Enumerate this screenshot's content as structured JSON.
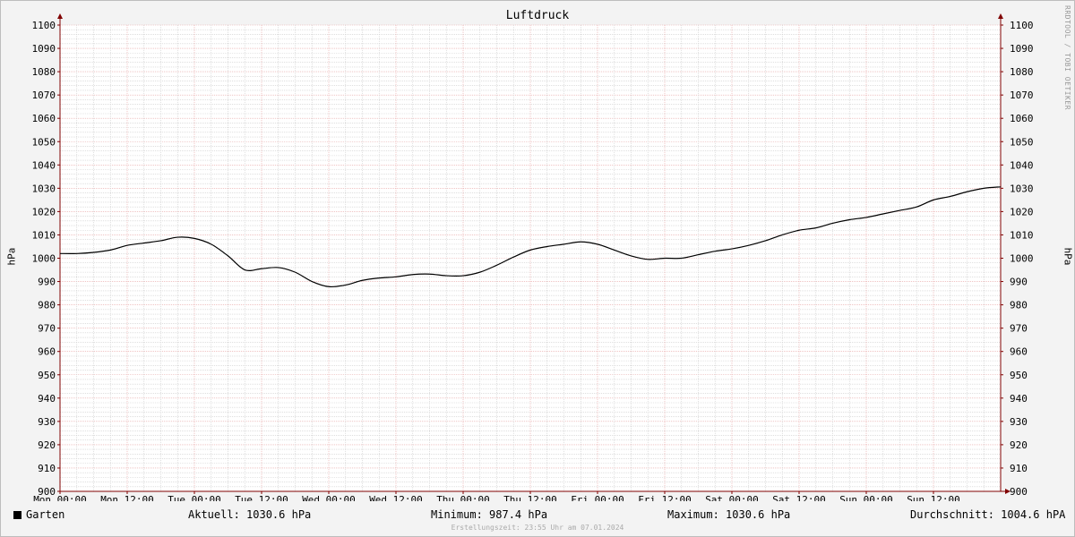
{
  "chart_data": {
    "type": "line",
    "title": "Luftdruck",
    "ylabel": "hPa",
    "ylim": [
      900,
      1100
    ],
    "yticks": [
      900,
      910,
      920,
      930,
      940,
      950,
      960,
      970,
      980,
      990,
      1000,
      1010,
      1020,
      1030,
      1040,
      1050,
      1060,
      1070,
      1080,
      1090,
      1100
    ],
    "xlim": [
      "Mon 00:00",
      "Sun 24:00"
    ],
    "xticks": [
      "Mon 00:00",
      "Mon 12:00",
      "Tue 00:00",
      "Tue 12:00",
      "Wed 00:00",
      "Wed 12:00",
      "Thu 00:00",
      "Thu 12:00",
      "Fri 00:00",
      "Fri 12:00",
      "Sat 00:00",
      "Sat 12:00",
      "Sun 00:00",
      "Sun 12:00"
    ],
    "grid": true,
    "series": [
      {
        "name": "Garten",
        "color": "#000000",
        "x": [
          "Mon 00:00",
          "Mon 03:00",
          "Mon 06:00",
          "Mon 09:00",
          "Mon 12:00",
          "Mon 15:00",
          "Mon 18:00",
          "Mon 21:00",
          "Tue 00:00",
          "Tue 03:00",
          "Tue 06:00",
          "Tue 09:00",
          "Tue 12:00",
          "Tue 15:00",
          "Tue 18:00",
          "Tue 21:00",
          "Wed 00:00",
          "Wed 03:00",
          "Wed 06:00",
          "Wed 09:00",
          "Wed 12:00",
          "Wed 15:00",
          "Wed 18:00",
          "Wed 21:00",
          "Thu 00:00",
          "Thu 03:00",
          "Thu 06:00",
          "Thu 09:00",
          "Thu 12:00",
          "Thu 15:00",
          "Thu 18:00",
          "Thu 21:00",
          "Fri 00:00",
          "Fri 03:00",
          "Fri 06:00",
          "Fri 09:00",
          "Fri 12:00",
          "Fri 15:00",
          "Fri 18:00",
          "Fri 21:00",
          "Sat 00:00",
          "Sat 03:00",
          "Sat 06:00",
          "Sat 09:00",
          "Sat 12:00",
          "Sat 15:00",
          "Sat 18:00",
          "Sat 21:00",
          "Sun 00:00",
          "Sun 03:00",
          "Sun 06:00",
          "Sun 09:00",
          "Sun 12:00",
          "Sun 15:00",
          "Sun 18:00",
          "Sun 21:00",
          "Sun 24:00"
        ],
        "values": [
          1002,
          1002,
          1002.5,
          1003.5,
          1005.5,
          1006.5,
          1007.5,
          1009,
          1008.5,
          1006,
          1001,
          995,
          995.5,
          996,
          994,
          990,
          987.8,
          988.5,
          990.5,
          991.5,
          992,
          993,
          993.2,
          992.5,
          992.5,
          994,
          997,
          1000.5,
          1003.5,
          1005,
          1006,
          1007,
          1006,
          1003.5,
          1001,
          999.5,
          1000,
          1000,
          1001.5,
          1003,
          1004,
          1005.5,
          1007.5,
          1010,
          1012,
          1013,
          1015,
          1016.5,
          1017.5,
          1019,
          1020.5,
          1022,
          1025,
          1026.5,
          1028.5,
          1030,
          1030.6
        ]
      }
    ]
  },
  "legend": {
    "series_name": "Garten",
    "current": "Aktuell: 1030.6 hPa",
    "minimum": "Minimum: 987.4 hPa",
    "maximum": "Maximum: 1030.6 hPa",
    "average": "Durchschnitt: 1004.6 hPA"
  },
  "footer": "Erstellungszeit: 23:55 Uhr am 07.01.2024",
  "watermark": "RRDTOOL / TOBI OETIKER",
  "colors": {
    "background": "#f3f3f3",
    "plot_background": "#ffffff",
    "grid_minor": "#cccccc",
    "grid_major": "#e6a0a0",
    "axis": "#800000",
    "line": "#000000"
  }
}
